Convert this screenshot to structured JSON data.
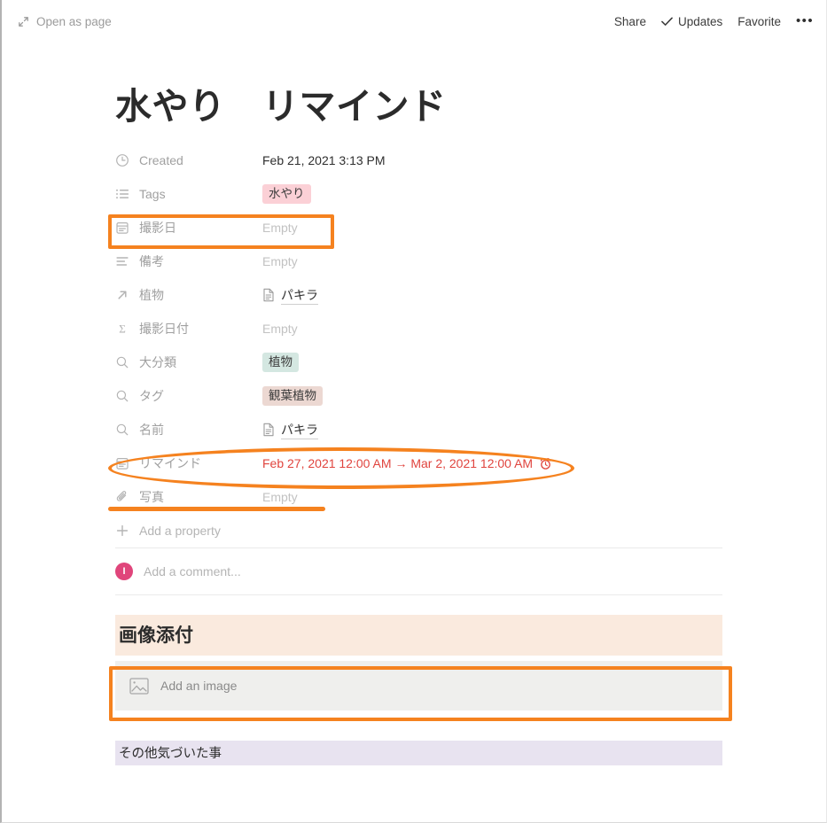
{
  "topbar": {
    "open_as_page": "Open as page",
    "share": "Share",
    "updates": "Updates",
    "favorite": "Favorite",
    "more": "•••"
  },
  "page": {
    "title": "水やり　リマインド"
  },
  "properties": [
    {
      "icon": "clock-icon",
      "name": "Created",
      "value": "Feb 21, 2021 3:13 PM",
      "type": "text"
    },
    {
      "icon": "multi-select-icon",
      "name": "Tags",
      "value": "水やり",
      "type": "tag-pink"
    },
    {
      "icon": "calendar-icon",
      "name": "撮影日",
      "value": "Empty",
      "type": "empty"
    },
    {
      "icon": "text-icon",
      "name": "備考",
      "value": "Empty",
      "type": "empty"
    },
    {
      "icon": "relation-icon",
      "name": "植物",
      "value": "パキラ",
      "type": "page-ref"
    },
    {
      "icon": "rollup-icon",
      "name": "撮影日付",
      "value": "Empty",
      "type": "empty"
    },
    {
      "icon": "lookup-icon",
      "name": "大分類",
      "value": "植物",
      "type": "tag-green"
    },
    {
      "icon": "lookup-icon",
      "name": "タグ",
      "value": "観葉植物",
      "type": "tag-brown"
    },
    {
      "icon": "lookup-icon",
      "name": "名前",
      "value": "パキラ",
      "type": "page-ref"
    },
    {
      "icon": "calendar-icon",
      "name": "リマインド",
      "value": "Feb 27, 2021 12:00 AM → Mar 2, 2021 12:00 AM",
      "type": "date-reminder"
    },
    {
      "icon": "paperclip-icon",
      "name": "写真",
      "value": "Empty",
      "type": "empty"
    }
  ],
  "add_property_label": "Add a property",
  "comment": {
    "avatar_initial": "I",
    "placeholder": "Add a comment..."
  },
  "blocks": {
    "heading": "画像添付",
    "image_placeholder": "Add an image",
    "text_block": "その他気づいた事"
  },
  "colors": {
    "annotation": "#f5821f",
    "reminder_text": "#e0443e",
    "tag_pink": "#fbd0d6",
    "tag_green": "#d4e7e1",
    "tag_brown": "#ecd8d2",
    "heading_bg": "#faeade",
    "text_block_bg": "#e8e3f0",
    "avatar_bg": "#e0457b"
  }
}
